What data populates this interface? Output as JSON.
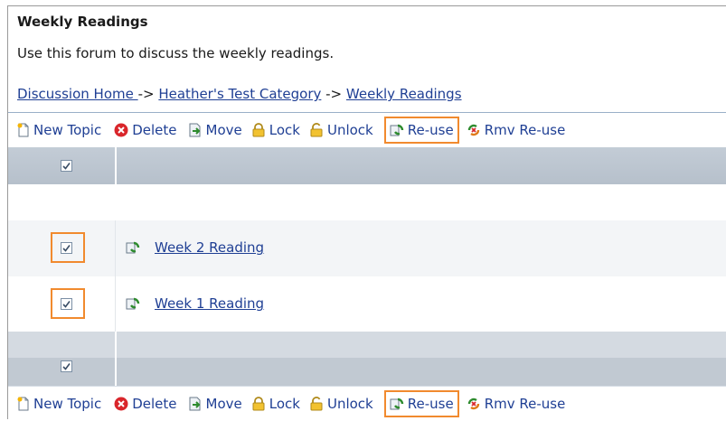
{
  "forum": {
    "title": "Weekly Readings",
    "description": "Use this forum to discuss the weekly readings."
  },
  "breadcrumb": {
    "home": "Discussion Home ",
    "sep1": " -> ",
    "category": "Heather's Test Category",
    "sep2": " -> ",
    "current": "Weekly Readings"
  },
  "toolbar": {
    "new_topic": "New Topic",
    "delete": "Delete",
    "move": "Move",
    "lock": "Lock",
    "unlock": "Unlock",
    "reuse": "Re-use",
    "rmv_reuse": "Rmv Re-use"
  },
  "topics": [
    {
      "title": "Week 2 Reading",
      "checked": true
    },
    {
      "title": "Week 1 Reading",
      "checked": true
    }
  ],
  "colors": {
    "link": "#1f3f94",
    "highlight": "#f18a2e",
    "header_row": "#bcc5cf"
  }
}
